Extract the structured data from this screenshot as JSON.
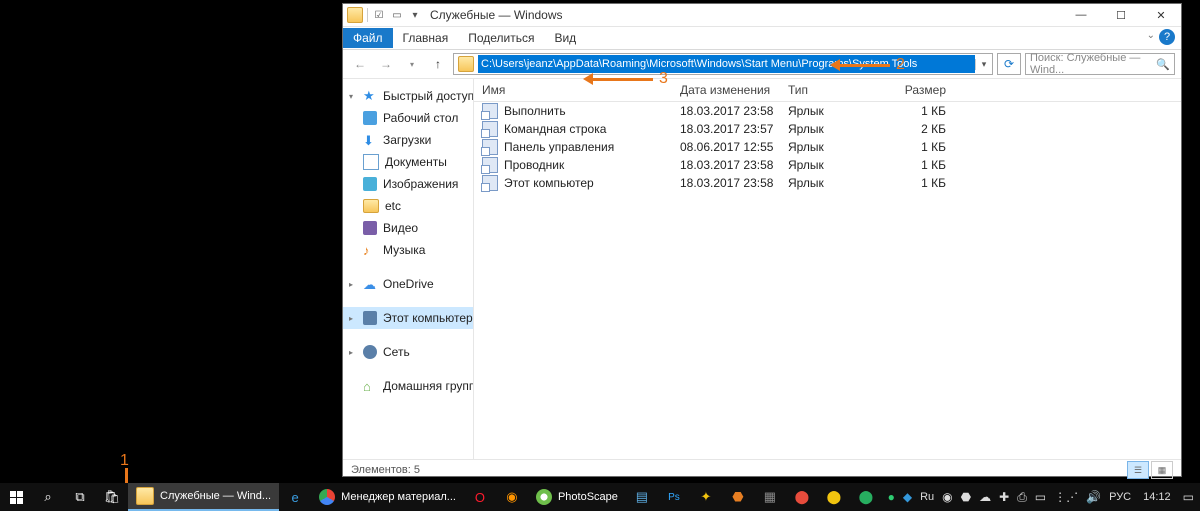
{
  "window": {
    "title": "Служебные — Windows",
    "tabs": {
      "file": "Файл",
      "home": "Главная",
      "share": "Поделиться",
      "view": "Вид"
    }
  },
  "address": {
    "path": "C:\\Users\\jeanz\\AppData\\Roaming\\Microsoft\\Windows\\Start Menu\\Programs\\System Tools",
    "search_placeholder": "Поиск: Служебные — Wind..."
  },
  "nav": {
    "quick": "Быстрый доступ",
    "items": [
      "Рабочий стол",
      "Загрузки",
      "Документы",
      "Изображения",
      "etc",
      "Видео",
      "Музыка"
    ],
    "onedrive": "OneDrive",
    "thispc": "Этот компьютер",
    "network": "Сеть",
    "homegroup": "Домашняя группа"
  },
  "columns": {
    "name": "Имя",
    "date": "Дата изменения",
    "type": "Тип",
    "size": "Размер"
  },
  "files": [
    {
      "name": "Выполнить",
      "date": "18.03.2017 23:58",
      "type": "Ярлык",
      "size": "1 КБ"
    },
    {
      "name": "Командная строка",
      "date": "18.03.2017 23:57",
      "type": "Ярлык",
      "size": "2 КБ"
    },
    {
      "name": "Панель управления",
      "date": "08.06.2017 12:55",
      "type": "Ярлык",
      "size": "1 КБ"
    },
    {
      "name": "Проводник",
      "date": "18.03.2017 23:58",
      "type": "Ярлык",
      "size": "1 КБ"
    },
    {
      "name": "Этот компьютер",
      "date": "18.03.2017 23:58",
      "type": "Ярлык",
      "size": "1 КБ"
    }
  ],
  "status": "Элементов: 5",
  "annotations": {
    "one": "1",
    "two": "2",
    "three": "3"
  },
  "taskbar": {
    "active": "Служебные — Wind...",
    "apps": [
      "Менеджер материал...",
      "PhotoScape"
    ],
    "lang_ind": "Ru",
    "lang": "РУС",
    "clock": "14:12"
  }
}
